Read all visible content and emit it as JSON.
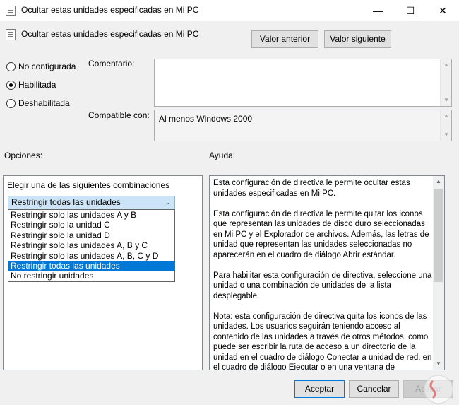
{
  "window": {
    "title": "Ocultar estas unidades especificadas en Mi PC",
    "minimize_glyph": "—",
    "maximize_glyph": "☐",
    "close_glyph": "✕"
  },
  "header": {
    "title": "Ocultar estas unidades especificadas en Mi PC",
    "prev_button": "Valor anterior",
    "next_button": "Valor siguiente"
  },
  "state": {
    "options": [
      {
        "label": "No configurada",
        "selected": false
      },
      {
        "label": "Habilitada",
        "selected": true
      },
      {
        "label": "Deshabilitada",
        "selected": false
      }
    ]
  },
  "comment": {
    "label": "Comentario:",
    "value": ""
  },
  "compatible": {
    "label": "Compatible con:",
    "value": "Al menos Windows 2000"
  },
  "options_panel": {
    "label": "Opciones:",
    "instruction": "Elegir una de las siguientes combinaciones",
    "selected_value": "Restringir todas las unidades",
    "items": [
      "Restringir solo las unidades A y B",
      "Restringir solo la unidad C",
      "Restringir solo la unidad D",
      "Restringir solo las unidades A, B y C",
      "Restringir solo las unidades A, B, C y D",
      "Restringir todas las unidades",
      "No restringir unidades"
    ],
    "highlighted_index": 5
  },
  "help_panel": {
    "label": "Ayuda:",
    "paragraphs": [
      "Esta configuración de directiva le permite ocultar estas unidades especificadas en Mi PC.",
      "Esta configuración de directiva le permite quitar los iconos que representan las unidades de disco duro seleccionadas en Mi PC y el Explorador de archivos. Además, las letras de unidad que representan las unidades seleccionadas no aparecerán en el cuadro de diálogo Abrir estándar.",
      "Para habilitar esta configuración de directiva, seleccione una unidad o una combinación de unidades de la lista desplegable.",
      "Nota: esta configuración de directiva quita los iconos de las unidades. Los usuarios seguirán teniendo acceso al contenido de las unidades a través de otros métodos, como puede ser escribir la ruta de acceso a un directorio de la unidad en el cuadro de diálogo Conectar a unidad de red, en el cuadro de diálogo Ejecutar o en una ventana de comandos."
    ]
  },
  "footer": {
    "accept": "Aceptar",
    "cancel": "Cancelar",
    "apply": "Aplicar"
  }
}
